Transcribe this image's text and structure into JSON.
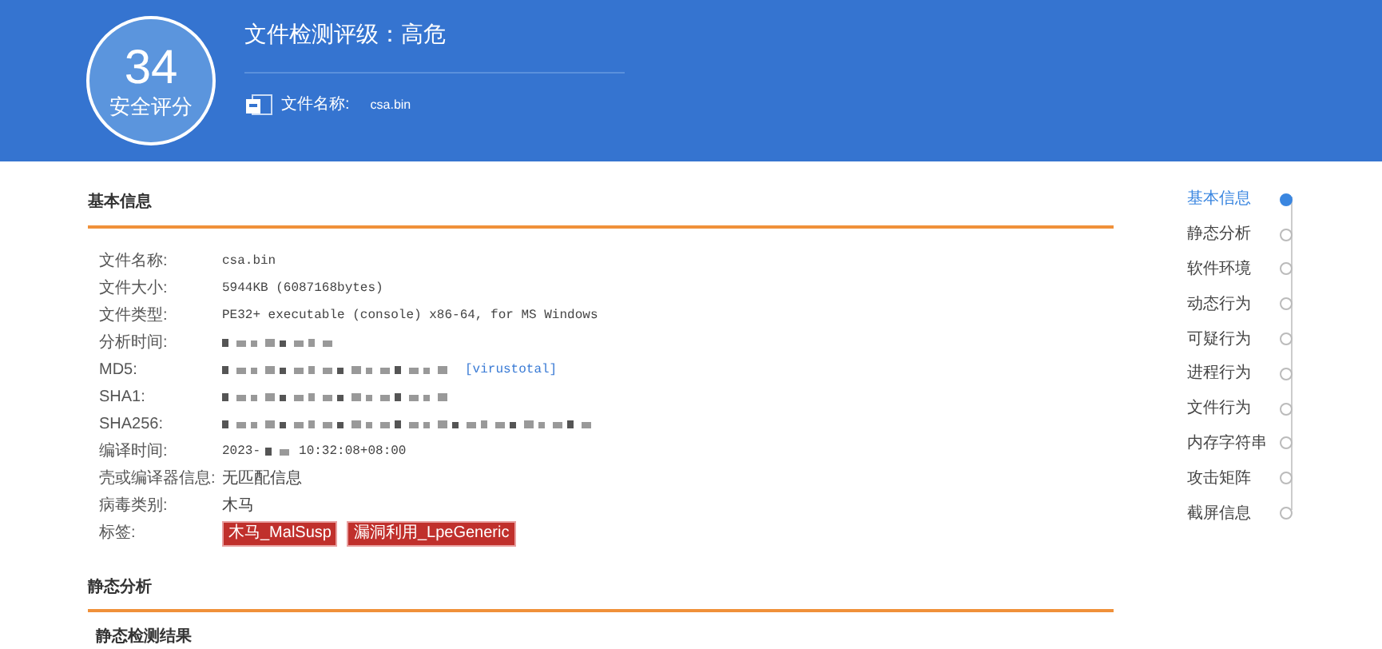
{
  "header": {
    "score": "34",
    "score_label": "安全评分",
    "title": "文件检测评级：高危",
    "file_label": "文件名称:",
    "file_name": "csa.bin"
  },
  "basic_info": {
    "title": "基本信息",
    "rows": [
      {
        "kind": "text",
        "label": "文件名称:",
        "value": "csa.bin",
        "mono": true
      },
      {
        "kind": "text",
        "label": "文件大小:",
        "value": "5944KB (6087168bytes)",
        "mono": true
      },
      {
        "kind": "text",
        "label": "文件类型:",
        "value": "PE32+ executable (console) x86-64, for MS Windows",
        "mono": true
      },
      {
        "kind": "blurred",
        "label": "分析时间:"
      },
      {
        "kind": "blurred_link",
        "label": "MD5:",
        "link": "[virustotal]"
      },
      {
        "kind": "blurred",
        "label": "SHA1:"
      },
      {
        "kind": "blurred",
        "label": "SHA256:"
      },
      {
        "kind": "partial",
        "label": "编译时间:",
        "prefix": "2023-",
        "value": "10:32:08+08:00"
      },
      {
        "kind": "text",
        "label": "壳或编译器信息:",
        "value": "无匹配信息",
        "mono": false
      },
      {
        "kind": "text",
        "label": "病毒类别:",
        "value": "木马",
        "mono": false
      },
      {
        "kind": "tags",
        "label": "标签:",
        "tags": [
          "木马_MalSusp",
          "漏洞利用_LpeGeneric"
        ]
      }
    ]
  },
  "static_analysis": {
    "title": "静态分析",
    "subtitle": "静态检测结果"
  },
  "nav": [
    {
      "label": "基本信息",
      "selected": true
    },
    {
      "label": "静态分析",
      "selected": false
    },
    {
      "label": "软件环境",
      "selected": false
    },
    {
      "label": "动态行为",
      "selected": false
    },
    {
      "label": "可疑行为",
      "selected": false
    },
    {
      "label": "进程行为",
      "selected": false
    },
    {
      "label": "文件行为",
      "selected": false
    },
    {
      "label": "内存字符串",
      "selected": false
    },
    {
      "label": "攻击矩阵",
      "selected": false
    },
    {
      "label": "截屏信息",
      "selected": false
    }
  ]
}
